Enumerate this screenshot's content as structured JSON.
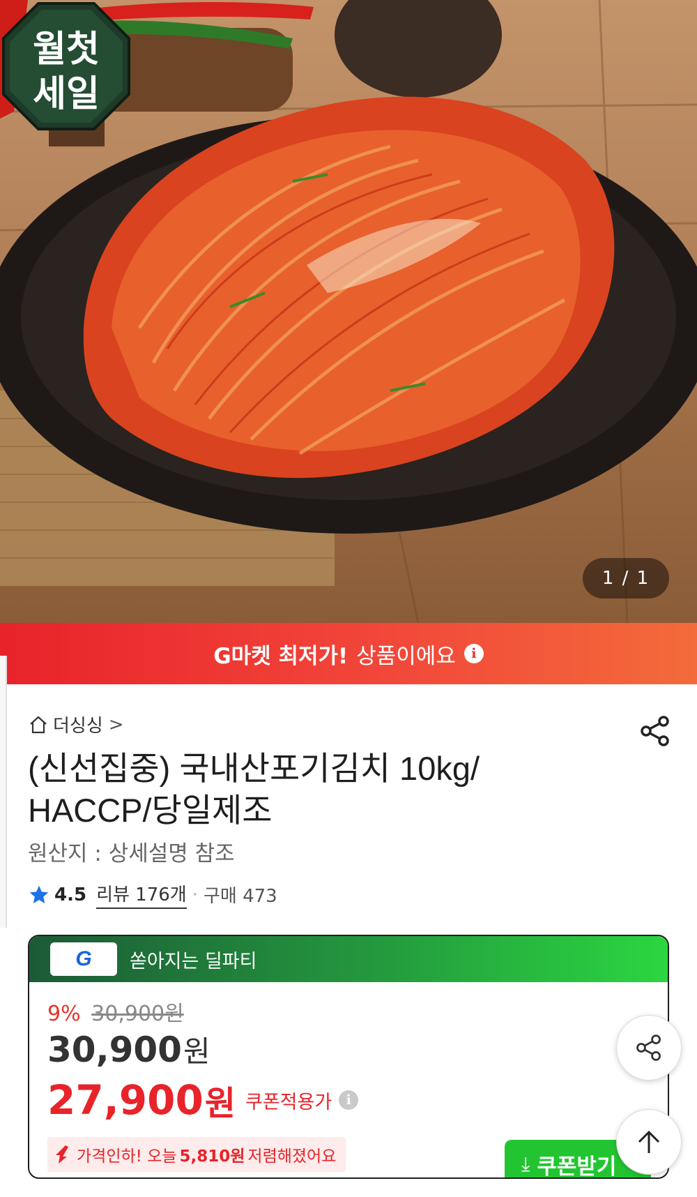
{
  "hero": {
    "badge_line1": "월첫",
    "badge_line2": "세일",
    "image_counter": "1 / 1"
  },
  "promo_bar": {
    "strong_text": "G마켓 최저가!",
    "soft_text": "상품이에요",
    "info_icon": "info-icon"
  },
  "product": {
    "shop_name": "더싱싱",
    "shop_chevron": ">",
    "title_line1": "(신선집중) 국내산포기김치 10kg/",
    "title_line2": "HACCP/당일제조",
    "origin": "원산지 : 상세설명 참조",
    "rating_score": "4.5",
    "reviews_label": "리뷰 176개",
    "rating_separator": "·",
    "purchase_label": "구매 473"
  },
  "deal": {
    "logo_text": "G",
    "title": "쏟아지는 딜파티",
    "discount_pct": "9%",
    "original_price": "30,900원",
    "price": "30,900",
    "price_unit": "원",
    "coupon_price": "27,900",
    "coupon_price_unit": "원",
    "coupon_label": "쿠폰적용가",
    "coupon_info_icon": "i",
    "price_drop_prefix": "가격인하! 오늘",
    "price_drop_amount": "5,810원",
    "price_drop_suffix": "저렴해졌어요",
    "coupon_button_icon": "⤓",
    "coupon_button_label": "쿠폰받기"
  },
  "floating": {
    "share_icon": "share-icon",
    "top_icon": "arrow-up-icon"
  },
  "colors": {
    "brand_red": "#e8232a",
    "deal_green": "#22c531",
    "star_blue": "#1a73e8"
  }
}
